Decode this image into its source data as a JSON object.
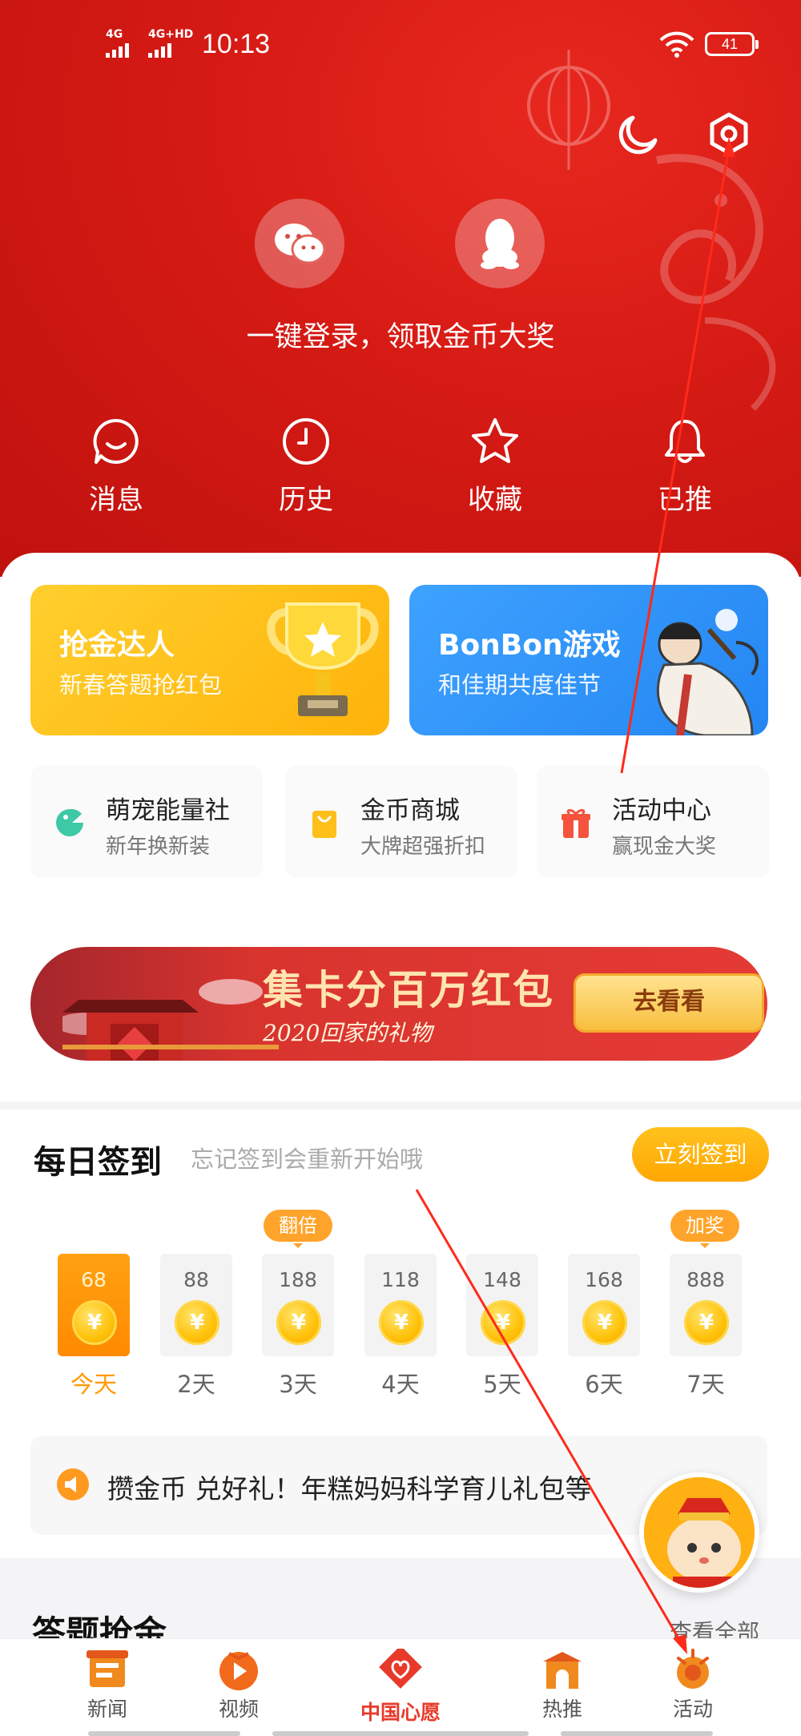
{
  "status_bar": {
    "network_1": "4G",
    "network_2": "4G+HD",
    "time": "10:13",
    "battery": "41"
  },
  "header": {
    "night_mode_icon": "moon-icon",
    "settings_icon": "gear-icon",
    "login_text": "一键登录，领取金币大奖",
    "login_options": [
      "wechat-icon",
      "qq-icon"
    ]
  },
  "quick_links": [
    {
      "label": "消息",
      "icon": "message-icon"
    },
    {
      "label": "历史",
      "icon": "clock-icon"
    },
    {
      "label": "收藏",
      "icon": "star-icon"
    },
    {
      "label": "已推",
      "icon": "bell-icon"
    }
  ],
  "banners": [
    {
      "title": "抢金达人",
      "subtitle": "新春答题抢红包",
      "color": "#ffbf1a"
    },
    {
      "title": "BonBon游戏",
      "subtitle": "和佳期共度佳节",
      "color": "#2f96fb"
    }
  ],
  "mini_entries": [
    {
      "title": "萌宠能量社",
      "subtitle": "新年换新装",
      "icon": "pet-icon",
      "color": "#3ec9a6"
    },
    {
      "title": "金币商城",
      "subtitle": "大牌超强折扣",
      "icon": "shopping-bag-icon",
      "color": "#ffbf1a"
    },
    {
      "title": "活动中心",
      "subtitle": "赢现金大奖",
      "icon": "gift-icon",
      "color": "#f5533d"
    }
  ],
  "card_banner": {
    "title": "集卡分百万红包",
    "subtitle": "2020回家的礼物",
    "button": "去看看"
  },
  "signin": {
    "title": "每日签到",
    "subtitle": "忘记签到会重新开始哦",
    "button": "立刻签到",
    "days": [
      {
        "amount": "68",
        "label": "今天",
        "tag": ""
      },
      {
        "amount": "88",
        "label": "2天",
        "tag": ""
      },
      {
        "amount": "188",
        "label": "3天",
        "tag": "翻倍"
      },
      {
        "amount": "118",
        "label": "4天",
        "tag": ""
      },
      {
        "amount": "148",
        "label": "5天",
        "tag": ""
      },
      {
        "amount": "168",
        "label": "6天",
        "tag": ""
      },
      {
        "amount": "888",
        "label": "7天",
        "tag": "加奖"
      }
    ],
    "coin_symbol": "¥"
  },
  "notice": {
    "text": "攒金币 兑好礼！年糕妈妈科学育儿礼包等"
  },
  "quiz": {
    "title": "答题抢金",
    "more": "查看全部"
  },
  "tabbar": [
    {
      "label": "新闻",
      "icon": "news-icon",
      "active": false
    },
    {
      "label": "视频",
      "icon": "video-icon",
      "active": false
    },
    {
      "label": "中国心愿",
      "icon": "china-knot-icon",
      "active": true
    },
    {
      "label": "热推",
      "icon": "gate-icon",
      "active": false
    },
    {
      "label": "活动",
      "icon": "activity-icon",
      "active": false
    }
  ],
  "colors": {
    "hero_red": "#d51a14",
    "accent_orange": "#ffa600",
    "active_tab": "#e83a2a"
  }
}
